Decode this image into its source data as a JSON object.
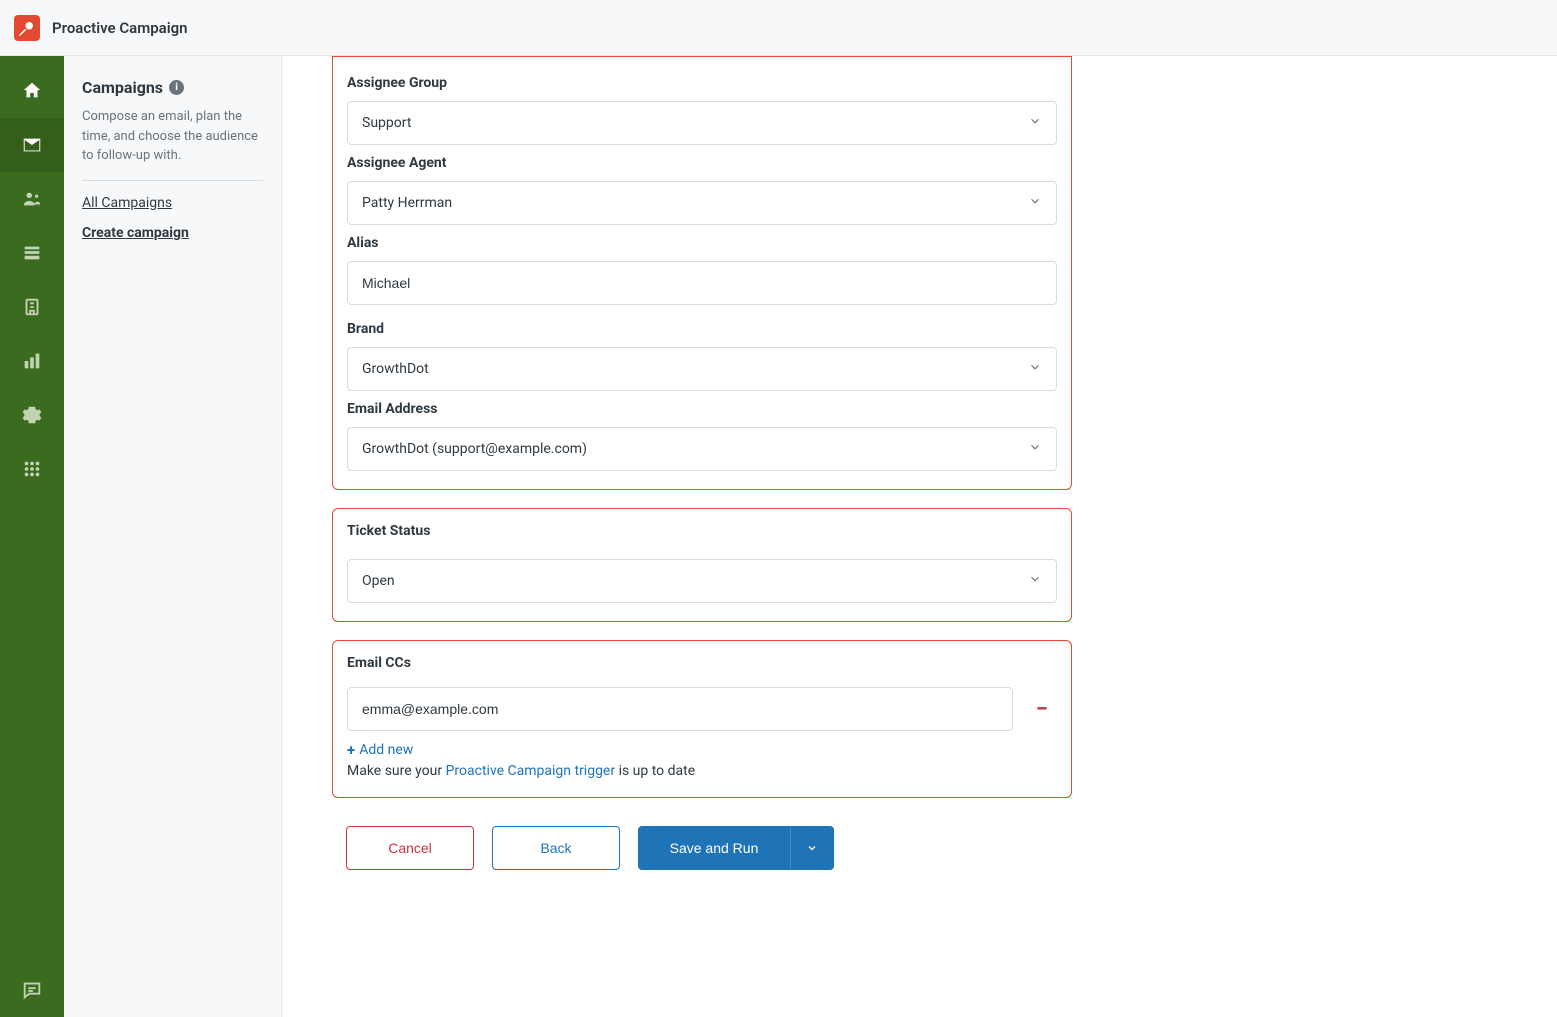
{
  "app": {
    "title": "Proactive Campaign"
  },
  "sidebar": {
    "title": "Campaigns",
    "description": "Compose an email, plan the time, and choose the audience to follow-up with.",
    "links": {
      "all": "All Campaigns",
      "create": "Create campaign"
    }
  },
  "form": {
    "assignee_group": {
      "label": "Assignee Group",
      "value": "Support"
    },
    "assignee_agent": {
      "label": "Assignee Agent",
      "value": "Patty Herrman"
    },
    "alias": {
      "label": "Alias",
      "value": "Michael"
    },
    "brand": {
      "label": "Brand",
      "value": "GrowthDot"
    },
    "email_address": {
      "label": "Email Address",
      "value": "GrowthDot (support@example.com)"
    },
    "ticket_status": {
      "label": "Ticket Status",
      "value": "Open"
    },
    "email_ccs": {
      "label": "Email CCs",
      "value": "emma@example.com",
      "add_new": "Add new",
      "help_pre": "Make sure your ",
      "help_link": "Proactive Campaign trigger",
      "help_post": " is up to date"
    }
  },
  "buttons": {
    "cancel": "Cancel",
    "back": "Back",
    "save_run": "Save and Run"
  }
}
